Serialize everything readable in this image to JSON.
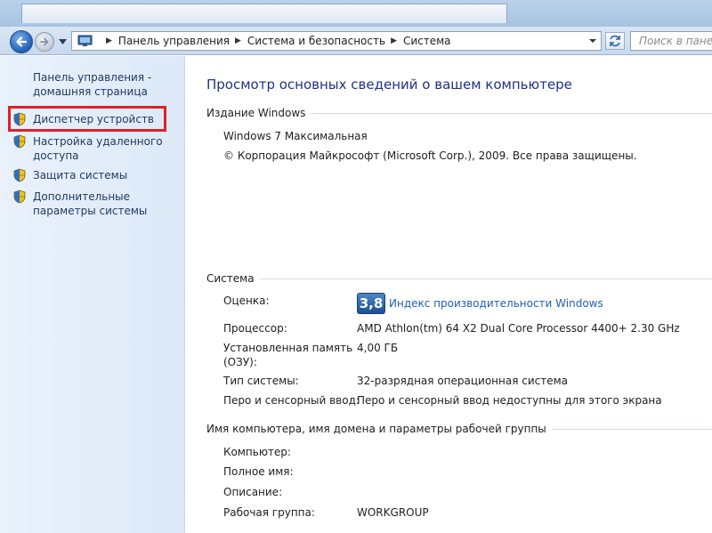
{
  "navigation": {
    "breadcrumbs": [
      "Панель управления",
      "Система и безопасность",
      "Система"
    ],
    "search_placeholder": "Поиск в панели"
  },
  "sidebar": {
    "home_link": "Панель управления - домашняя страница",
    "items": [
      {
        "label": "Диспетчер устройств",
        "icon": "shield-icon",
        "highlighted": true
      },
      {
        "label": "Настройка удаленного доступа",
        "icon": "shield-icon"
      },
      {
        "label": "Защита системы",
        "icon": "shield-icon"
      },
      {
        "label": "Дополнительные параметры системы",
        "icon": "shield-icon"
      }
    ],
    "highlight_color": "#e0202a"
  },
  "main": {
    "title": "Просмотр основных сведений о вашем компьютере",
    "windows_edition": {
      "heading": "Издание Windows",
      "edition": "Windows 7 Максимальная",
      "copyright": "© Корпорация Майкрософт (Microsoft Corp.), 2009. Все права защищены."
    },
    "system": {
      "heading": "Система",
      "rating_label": "Оценка:",
      "rating_score": "3,8",
      "rating_link": "Индекс производительности Windows",
      "processor_label": "Процессор:",
      "processor_value": "AMD Athlon(tm) 64 X2 Dual Core Processor 4400+   2.30 GHz",
      "memory_label_line1": "Установленная память",
      "memory_label_line2": "(ОЗУ):",
      "memory_value": "4,00 ГБ",
      "type_label": "Тип системы:",
      "type_value": "32-разрядная операционная система",
      "pen_label": "Перо и сенсорный ввод:",
      "pen_value": "Перо и сенсорный ввод недоступны для этого экрана"
    },
    "computer_name": {
      "heading": "Имя компьютера, имя домена и параметры рабочей группы",
      "computer_label": "Компьютер:",
      "fullname_label": "Полное имя:",
      "description_label": "Описание:",
      "workgroup_label": "Рабочая группа:",
      "workgroup_value": "WORKGROUP"
    }
  },
  "colors": {
    "link": "#1e395b",
    "title": "#1e3287",
    "accent_blue": "#1f5fb4"
  }
}
